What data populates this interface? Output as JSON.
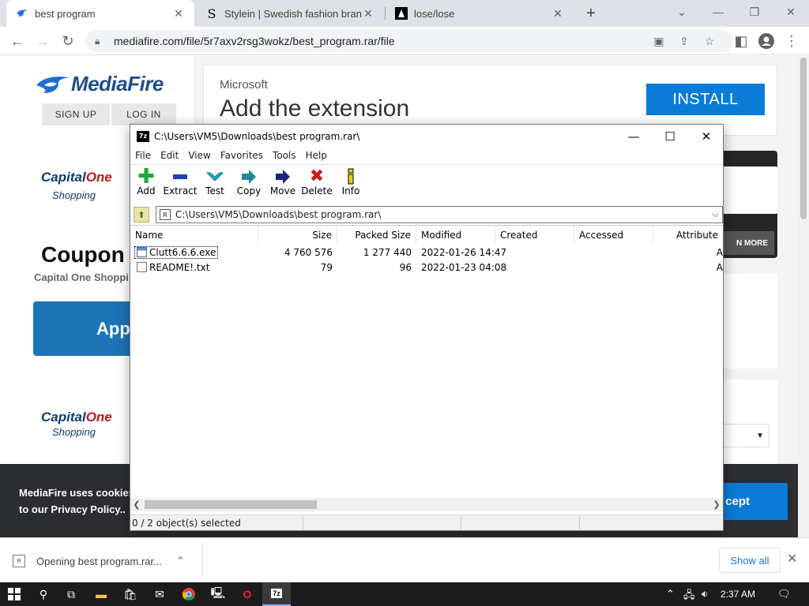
{
  "browser": {
    "tabs": [
      {
        "title": "best program",
        "favicon": "mediafire-icon",
        "active": true
      },
      {
        "title": "Stylein | Swedish fashion brand",
        "favicon": "S",
        "active": false
      },
      {
        "title": "lose/lose",
        "favicon": "lose-icon",
        "active": false
      }
    ],
    "url": "mediafire.com/file/5r7axv2rsg3wokz/best_program.rar/file"
  },
  "mediafire": {
    "logo": "MediaFire",
    "sign_up": "SIGN UP",
    "log_in": "LOG IN",
    "capital_one": {
      "capital": "Capital",
      "one": "One",
      "shopping": "Shopping"
    },
    "coupon": "Coupon",
    "coupon_sub": "Capital One Shoppi",
    "app_btn": "App",
    "ad_brand": "Microsoft",
    "ad_headline": "Add the extension",
    "install": "INSTALL",
    "learn_more": "N MORE",
    "cookie_text": "MediaFire uses cookies to our Privacy Policy..",
    "accept": "cept"
  },
  "zip": {
    "title": "C:\\Users\\VM5\\Downloads\\best program.rar\\",
    "app_icon": "7z",
    "menu": [
      "File",
      "Edit",
      "View",
      "Favorites",
      "Tools",
      "Help"
    ],
    "tools": [
      {
        "label": "Add",
        "icon": "plus-icon",
        "color": "#22a63a"
      },
      {
        "label": "Extract",
        "icon": "minus-icon",
        "color": "#1f3fbf"
      },
      {
        "label": "Test",
        "icon": "check-icon",
        "color": "#1aa6c9"
      },
      {
        "label": "Copy",
        "icon": "copy-arrow-icon",
        "color": "#20899a"
      },
      {
        "label": "Move",
        "icon": "move-arrow-icon",
        "color": "#1a237e"
      },
      {
        "label": "Delete",
        "icon": "delete-x-icon",
        "color": "#d01b1b"
      },
      {
        "label": "Info",
        "icon": "info-icon",
        "color": "#b8a300"
      }
    ],
    "path": "C:\\Users\\VM5\\Downloads\\best program.rar\\",
    "columns": [
      "Name",
      "Size",
      "Packed Size",
      "Modified",
      "Created",
      "Accessed",
      "Attribute"
    ],
    "files": [
      {
        "name": "Clutt6.6.6.exe",
        "size": "4 760 576",
        "packed": "1 277 440",
        "modified": "2022-01-26 14:47",
        "created": "",
        "accessed": "",
        "attr": "A"
      },
      {
        "name": "README!.txt",
        "size": "79",
        "packed": "96",
        "modified": "2022-01-23 04:08",
        "created": "",
        "accessed": "",
        "attr": "A"
      }
    ],
    "status": "0 / 2 object(s) selected"
  },
  "download": {
    "item": "Opening best program.rar...",
    "show_all": "Show all"
  },
  "taskbar": {
    "time": "2:37 AM"
  }
}
